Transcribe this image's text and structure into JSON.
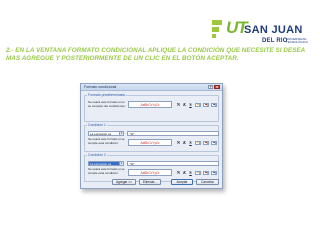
{
  "header": {
    "logo_text": "UT",
    "brand_name": "SAN JUAN",
    "brand_sub": "DEL RIO",
    "brand_tag": "UNIVERSIDAD TECNOLÓGICA",
    "instruction": "2.- EN LA VENTANA FORMATO CONDICIONAL APLIQUE LA CONDICIÓN QUE NECESITE SI DESEA MAS AGREGUE Y POSTERIORMENTE DE UN CLIC EN EL BOTÓN ACEPTAR."
  },
  "dialog": {
    "title": "Formato condicional",
    "help_label": "?",
    "close_label": "X",
    "groups": [
      {
        "label": "Formato predeterminado",
        "description": "Se usará este formato si no se cumplen las condiciones:",
        "preview_text": "AaBbCcYyZz"
      },
      {
        "label": "Condición 1",
        "condition": "La expresión es",
        "value": "\"Si\"",
        "description": "Se usará este formato si se cumple esta condición:",
        "preview_text": "AaBbCcYyZz"
      },
      {
        "label": "Condición 2",
        "condition": "La expresión es",
        "value": "\"Si\"",
        "description": "Se usará este formato si se cumple esta condición:",
        "preview_text": "AaBbCcYyZz"
      }
    ],
    "toolbar": {
      "bold": "N",
      "italic": "K",
      "underline": "S"
    },
    "buttons": {
      "add": "Agregar >>",
      "delete": "Eliminar...",
      "accept": "Aceptar",
      "cancel": "Cancelar"
    }
  },
  "colors": {
    "instruction_green": "#9ac94a",
    "brand_blue": "#1f3c7a",
    "logo_green": "#7ab72d",
    "preview_red": "#c23b3b"
  }
}
